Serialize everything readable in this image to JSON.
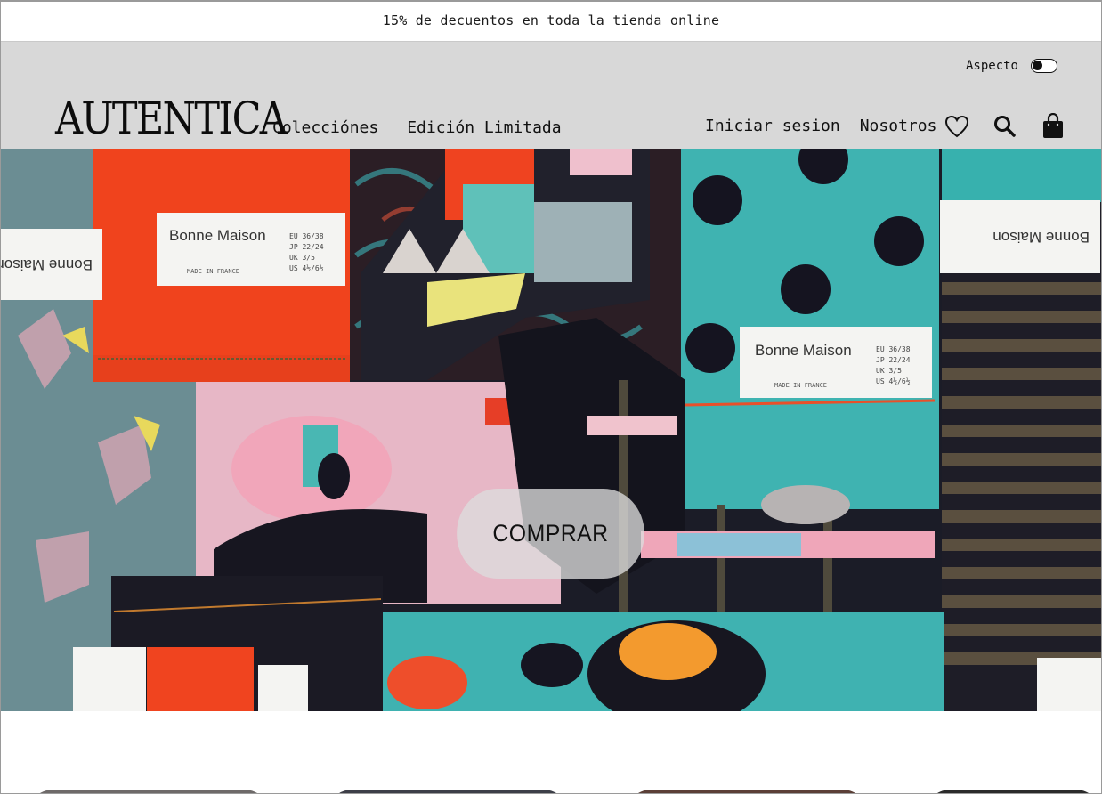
{
  "promo": {
    "text": "15% de decuentos en toda la tienda online"
  },
  "header": {
    "appearance_label": "Aspecto",
    "logo": "AUTENTICA",
    "nav_left": [
      "Colecciónes",
      "Edición Limitada"
    ],
    "nav_right": [
      "Iniciar sesion",
      "Nosotros"
    ],
    "icons": [
      "heart-icon",
      "search-icon",
      "shopping-bag-icon"
    ]
  },
  "hero": {
    "cta_label": "COMPRAR",
    "labels": [
      {
        "brand": "Bonne Maison",
        "origin": "MADE IN FRANCE",
        "sizes": [
          "EU 36/38",
          "JP 22/24",
          "UK 3/5",
          "US 4½/6½"
        ]
      },
      {
        "brand": "Bonne Maison",
        "origin": "MADE IN FRANCE",
        "sizes": [
          "EU 36/38",
          "JP 22/24",
          "UK 3/5",
          "US 4½/6½"
        ]
      }
    ]
  },
  "colors": {
    "header_bg": "#d8d8d8",
    "promo_bg": "#ffffff",
    "cta_bg": "#dcdcdc",
    "text": "#111111"
  }
}
